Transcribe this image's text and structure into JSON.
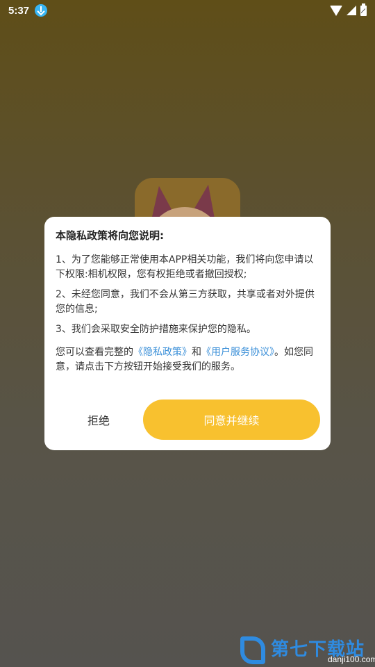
{
  "status_bar": {
    "time": "5:37",
    "icons": [
      "download-icon",
      "wifi-icon",
      "signal-icon",
      "battery-icon"
    ]
  },
  "dialog": {
    "title": "本隐私政策将向您说明:",
    "item1": "1、为了您能够正常使用本APP相关功能，我们将向您申请以下权限:相机权限，您有权拒绝或者撤回授权;",
    "item2": "2、未经您同意，我们不会从第三方获取，共享或者对外提供您的信息;",
    "item3": "3、我们会采取安全防护措施来保护您的隐私。",
    "notice_prefix": "您可以查看完整的",
    "privacy_link": "《隐私政策》",
    "notice_and": "和",
    "terms_link": "《用户服务协议》",
    "notice_suffix": "。如您同意，请点击下方按钮开始接受我们的服务。",
    "reject_label": "拒绝",
    "accept_label": "同意并继续"
  },
  "watermark": {
    "text": "第七下载站",
    "url": "danji100.com"
  },
  "colors": {
    "accent": "#f8c12f",
    "link": "#3a8fd8"
  }
}
